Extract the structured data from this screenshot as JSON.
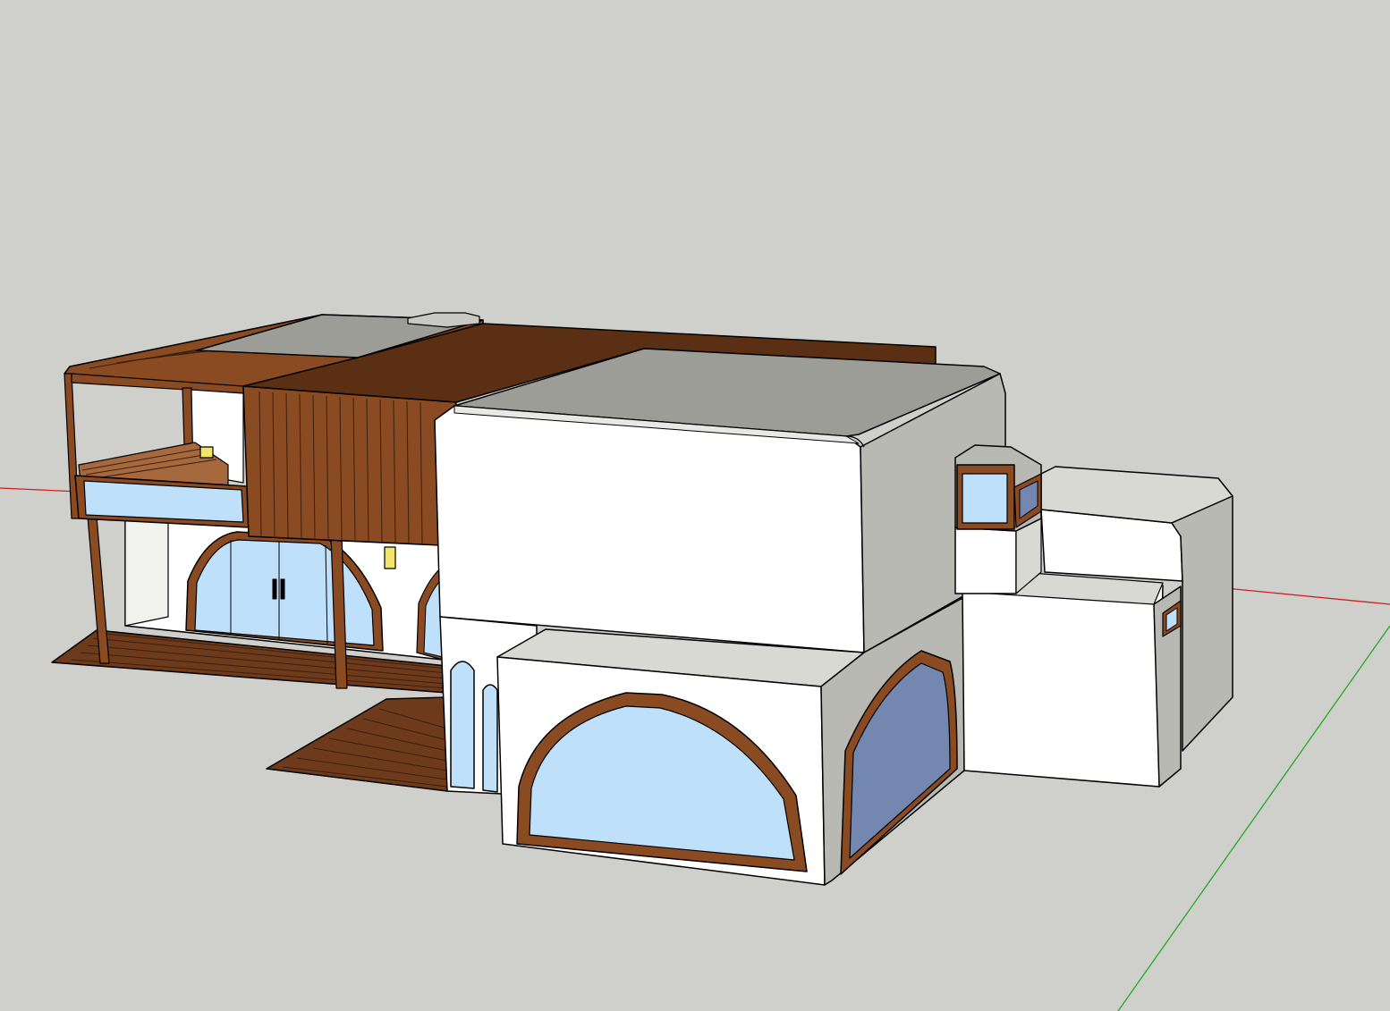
{
  "viewport": {
    "sky_color": "#cfcfcb",
    "ground_color": "#d3d3d0",
    "axis_colors": {
      "x": "#cc2020",
      "y": "#22aa22"
    }
  },
  "palette": {
    "wall_white": "#ffffff",
    "wall_grey_light": "#d9d9d4",
    "wall_grey_mid": "#b9b9b3",
    "roof_grey": "#9d9d97",
    "wood": "#8a4a22",
    "wood_dark": "#5a2f14",
    "glass_light": "#bfe0fb",
    "glass_shaded": "#7487b0",
    "edge": "#000000"
  },
  "model": {
    "description_icons": [
      "house-model",
      "deck",
      "pergola",
      "arched-window",
      "door",
      "lamp"
    ]
  }
}
